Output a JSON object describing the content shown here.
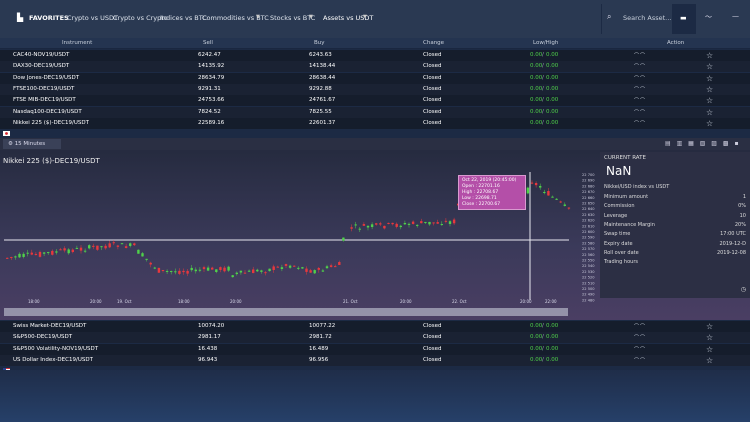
{
  "nav": {
    "favorites": "FAVORITES",
    "crypto_usdt": "Crypto vs USDT",
    "crypto_crypto": "Crypto vs Crypto",
    "indices_btc": "Indices vs BTC",
    "commodities_btc": "Commodities vs BTC",
    "stocks_btc": "Stocks vs BTC",
    "assets_usdt": "Assets vs USDT",
    "search_placeholder": "Search Asset..."
  },
  "table": {
    "headers": {
      "instrument": "Instrument",
      "sell": "Sell",
      "buy": "Buy",
      "change": "Change",
      "lowhigh": "Low/High",
      "action": "Action"
    },
    "rows_top": [
      {
        "name": "CAC40-NOV19/USDT",
        "sell": "6242.47",
        "buy": "6243.63",
        "change": "Closed",
        "low": "0.00",
        "high": "0.00",
        "flag": "fr"
      },
      {
        "name": "DAX30-DEC19/USDT",
        "sell": "14135.92",
        "buy": "14138.44",
        "change": "Closed",
        "low": "0.00",
        "high": "0.00",
        "flag": "de"
      },
      {
        "name": "Dow Jones-DEC19/USDT",
        "sell": "28634.79",
        "buy": "28638.44",
        "change": "Closed",
        "low": "0.00",
        "high": "0.00",
        "flag": "us"
      },
      {
        "name": "FTSE100-DEC19/USDT",
        "sell": "9291.31",
        "buy": "9292.88",
        "change": "Closed",
        "low": "0.00",
        "high": "0.00",
        "flag": "gb"
      },
      {
        "name": "FTSE MIB-DEC19/USDT",
        "sell": "24753.66",
        "buy": "24761.67",
        "change": "Closed",
        "low": "0.00",
        "high": "0.00",
        "flag": "it"
      },
      {
        "name": "Nasdaq100-DEC19/USDT",
        "sell": "7824.52",
        "buy": "7825.55",
        "change": "Closed",
        "low": "0.00",
        "high": "0.00",
        "flag": "us"
      },
      {
        "name": "Nikkei 225 ($)-DEC19/USDT",
        "sell": "22589.16",
        "buy": "22601.37",
        "change": "Closed",
        "low": "0.00",
        "high": "0.00",
        "flag": "jp"
      }
    ],
    "rows_bottom": [
      {
        "name": "Swiss Market-DEC19/USDT",
        "sell": "10074.20",
        "buy": "10077.22",
        "change": "Closed",
        "low": "0.00",
        "high": "0.00",
        "flag": "ch"
      },
      {
        "name": "S&P500-DEC19/USDT",
        "sell": "2981.17",
        "buy": "2981.72",
        "change": "Closed",
        "low": "0.00",
        "high": "0.00",
        "flag": "us"
      },
      {
        "name": "S&P500 Volatility-NOV19/USDT",
        "sell": "16.438",
        "buy": "16.489",
        "change": "Closed",
        "low": "0.00",
        "high": "0.00",
        "flag": "us"
      },
      {
        "name": "US Dollar Index-DEC19/USDT",
        "sell": "96.943",
        "buy": "96.956",
        "change": "Closed",
        "low": "0.00",
        "high": "0.00",
        "flag": "us"
      }
    ]
  },
  "chart": {
    "timeframe": "15 Minutes",
    "title": "Nikkei 225 ($)-DEC19/USDT",
    "tooltip": {
      "date": "Oct 22, 2019 (20:45:00)",
      "open": "Open : 22701.16",
      "high": "High : 22708.67",
      "low": "Low : 22698.71",
      "close": "Close : 22700.67"
    },
    "x_labels": [
      "18:00",
      "20:00",
      "19. Oct",
      "18:00",
      "20:00",
      "21. Oct",
      "20:00",
      "22. Oct",
      "20:00",
      "22:00"
    ],
    "y_labels": [
      "22 700",
      "22 690",
      "22 680",
      "22 670",
      "22 660",
      "22 650",
      "22 640",
      "22 630",
      "22 620",
      "22 610",
      "22 600",
      "22 590",
      "22 580",
      "22 570",
      "22 560",
      "22 550",
      "22 540",
      "22 530",
      "22 520",
      "22 510",
      "22 500",
      "22 490",
      "22 480"
    ]
  },
  "info": {
    "current_rate_label": "CURRENT RATE",
    "current_rate_value": "NaN",
    "instrument_name": "Nikkei/USD index vs USDT",
    "rows": [
      {
        "label": "Minimum amount",
        "value": "1"
      },
      {
        "label": "Commission",
        "value": "0%"
      },
      {
        "label": "Leverage",
        "value": "10"
      },
      {
        "label": "Maintenance Margin",
        "value": "20%"
      },
      {
        "label": "Swap time",
        "value": "17:00 UTC"
      },
      {
        "label": "Expiry date",
        "value": "2019-12-D"
      },
      {
        "label": "Roll over date",
        "value": "2019-12-08"
      },
      {
        "label": "Trading hours",
        "value": ""
      }
    ]
  },
  "colors": {
    "up": "#4fd14a",
    "down": "#e8383d",
    "tooltip": "#b44fa8"
  }
}
